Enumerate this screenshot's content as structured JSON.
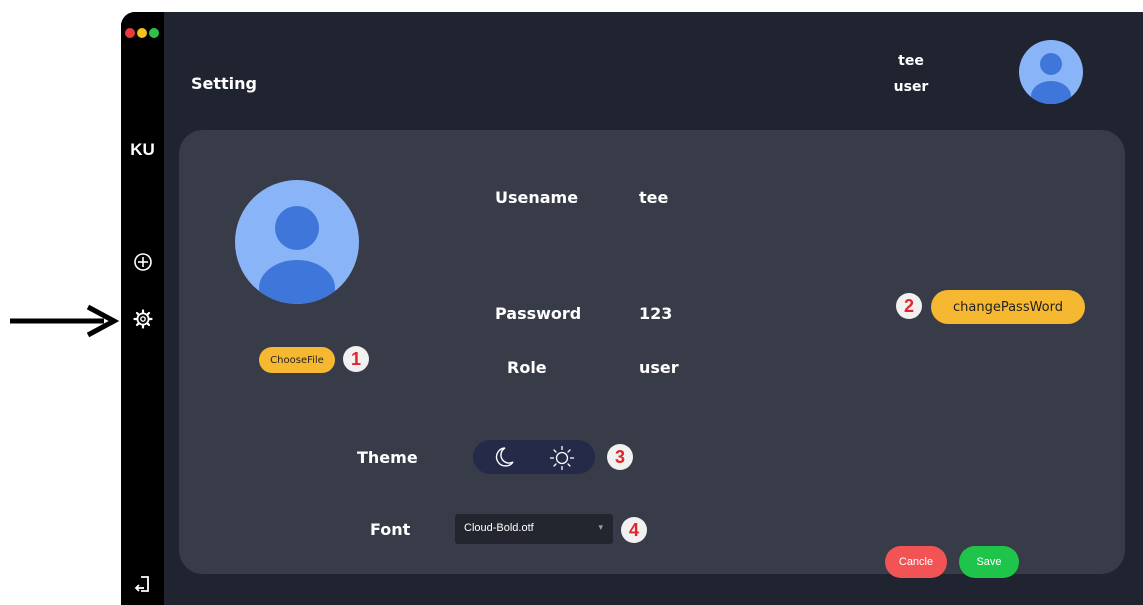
{
  "window": {
    "title": "Setting",
    "brand": "KU"
  },
  "sidebar": {
    "items": [
      {
        "icon": "add-icon"
      },
      {
        "icon": "gear-icon"
      },
      {
        "icon": "logout-icon"
      }
    ]
  },
  "header": {
    "username": "tee",
    "role": "user"
  },
  "profile": {
    "fields": {
      "username_label": "Usename",
      "username_value": "tee",
      "password_label": "Password",
      "password_value": "123",
      "role_label": "Role",
      "role_value": "user"
    },
    "choose_file_label": "ChooseFile",
    "change_password_label": "changePassWord"
  },
  "appearance": {
    "theme_label": "Theme",
    "font_label": "Font",
    "font_selected": "Cloud-Bold.otf"
  },
  "actions": {
    "cancel_label": "Cancle",
    "save_label": "Save"
  },
  "annotations": {
    "badge_1": "1",
    "badge_2": "2",
    "badge_3": "3",
    "badge_4": "4"
  },
  "colors": {
    "window_bg": "#202431",
    "panel_bg": "#383c48",
    "accent_yellow": "#f6b830",
    "cancel_red": "#f25455",
    "save_green": "#1fc54a",
    "avatar_blue": "#8ab4f8"
  }
}
